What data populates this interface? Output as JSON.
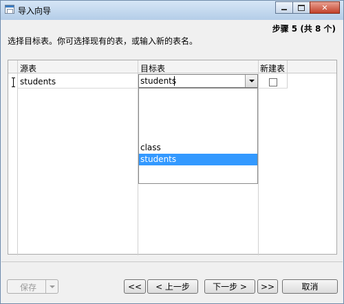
{
  "window": {
    "title": "导入向导"
  },
  "wizard": {
    "step_text": "步骤 5 (共 8 个)",
    "instruction": "选择目标表。你可选择现有的表，或输入新的表名。"
  },
  "grid": {
    "columns": [
      "源表",
      "目标表",
      "新建表"
    ],
    "rows": [
      {
        "source": "students",
        "target": "students",
        "new_table": false
      }
    ]
  },
  "dropdown": {
    "options": [
      "class",
      "students"
    ],
    "selected": "students"
  },
  "buttons": {
    "save": "保存",
    "first": "<<",
    "prev": "< 上一步",
    "next": "下一步 >",
    "last": ">>",
    "cancel": "取消"
  },
  "colors": {
    "selection": "#3399ff",
    "close_button": "#c2412a"
  }
}
